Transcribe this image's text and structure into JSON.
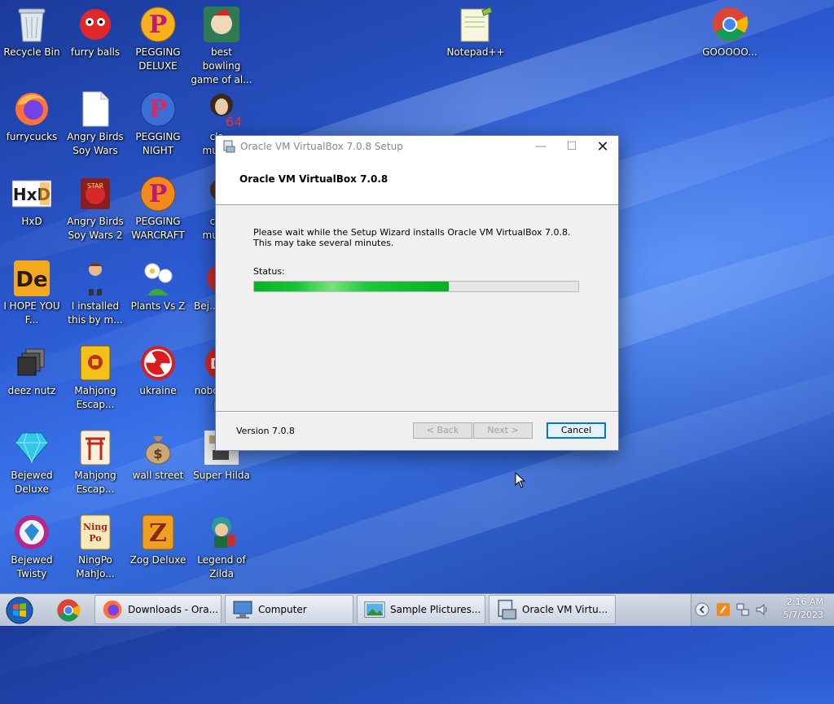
{
  "desktop": {
    "icons": [
      {
        "label": "Recycle Bin",
        "icon": "recycle-bin-icon"
      },
      {
        "label": "furry balls",
        "icon": "furry-ball-icon"
      },
      {
        "label": "PEGGING DELUXE",
        "icon": "pegging-icon"
      },
      {
        "label": "best bowling game of al...",
        "icon": "bowling-game-icon"
      },
      {
        "label": "Notepad++",
        "icon": "notepad-plus-plus-icon"
      },
      {
        "label": "GOOOOO...",
        "icon": "chrome-icon"
      },
      {
        "label": "furrycucks",
        "icon": "firefox-icon"
      },
      {
        "label": "Angry Birds Soy Wars",
        "icon": "blank-file-icon"
      },
      {
        "label": "PEGGING NIGHT",
        "icon": "pegging-night-icon"
      },
      {
        "label": "cla... music...",
        "icon": "classical-music-icon"
      },
      {
        "label": "HxD",
        "icon": "hxd-icon"
      },
      {
        "label": "Angry Birds Soy Wars 2",
        "icon": "angry-birds-icon"
      },
      {
        "label": "PEGGING WARCRAFT",
        "icon": "pegging-warcraft-icon"
      },
      {
        "label": "cla... music...",
        "icon": "classical-music-icon"
      },
      {
        "label": "I HOPE YOU F...",
        "icon": "de-icon"
      },
      {
        "label": "I installed this by m...",
        "icon": "character-icon"
      },
      {
        "label": "Plants Vs Z",
        "icon": "plants-vs-zombies-icon"
      },
      {
        "label": "Bej... The...",
        "icon": "bejeweled-icon"
      },
      {
        "label": "deez nutz",
        "icon": "stack-icon"
      },
      {
        "label": "Mahjong Escap...",
        "icon": "mahjong-icon"
      },
      {
        "label": "ukraine",
        "icon": "radiation-icon"
      },
      {
        "label": "nobo... can p...",
        "icon": "dc-icon"
      },
      {
        "label": "Bejewed Deluxe",
        "icon": "diamond-icon"
      },
      {
        "label": "Mahjong Escap...",
        "icon": "mahjong-gate-icon"
      },
      {
        "label": "wall street",
        "icon": "money-bag-icon"
      },
      {
        "label": "Super Hilda",
        "icon": "super-hilda-icon"
      },
      {
        "label": "Bejewed Twisty",
        "icon": "bejeweled-twist-icon"
      },
      {
        "label": "NingPo MahJo...",
        "icon": "ningpo-icon"
      },
      {
        "label": "Zog Deluxe",
        "icon": "zog-icon"
      },
      {
        "label": "Legend of Zilda",
        "icon": "zilda-icon"
      }
    ]
  },
  "dialog": {
    "title": "Oracle VM VirtualBox 7.0.8 Setup",
    "header_title": "Oracle VM VirtualBox 7.0.8",
    "message": "Please wait while the Setup Wizard installs Oracle VM VirtualBox 7.0.8. This may take several minutes.",
    "status_label": "Status:",
    "progress_fraction": 0.6,
    "version": "Version 7.0.8",
    "back_label": "< Back",
    "next_label": "Next >",
    "cancel_label": "Cancel",
    "minimize_glyph": "—",
    "maximize_glyph": "☐",
    "close_glyph": "✕"
  },
  "taskbar": {
    "tasks": [
      {
        "label": "Downloads - Ora...",
        "icon": "firefox-icon"
      },
      {
        "label": "Computer",
        "icon": "computer-icon"
      },
      {
        "label": "Sample Plictures...",
        "icon": "pictures-icon"
      },
      {
        "label": "Oracle VM Virtu...",
        "icon": "installer-icon"
      }
    ],
    "clock_time": "2:16 AM",
    "clock_date": "5/7/2023"
  },
  "colors": {
    "progress_green": "#07b225",
    "accent_blue": "#0078d7"
  }
}
